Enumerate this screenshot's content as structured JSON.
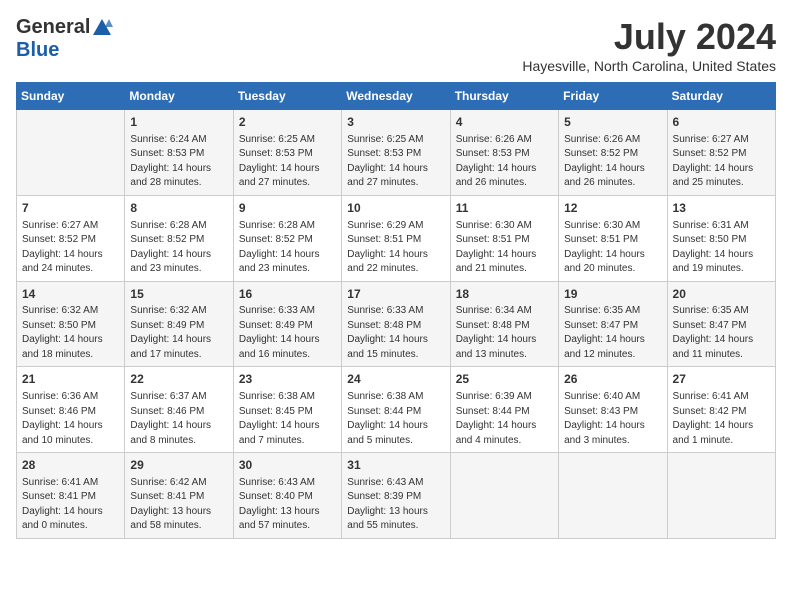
{
  "logo": {
    "general": "General",
    "blue": "Blue"
  },
  "title": {
    "month_year": "July 2024",
    "location": "Hayesville, North Carolina, United States"
  },
  "days_of_week": [
    "Sunday",
    "Monday",
    "Tuesday",
    "Wednesday",
    "Thursday",
    "Friday",
    "Saturday"
  ],
  "weeks": [
    [
      {
        "day": "",
        "info": ""
      },
      {
        "day": "1",
        "info": "Sunrise: 6:24 AM\nSunset: 8:53 PM\nDaylight: 14 hours\nand 28 minutes."
      },
      {
        "day": "2",
        "info": "Sunrise: 6:25 AM\nSunset: 8:53 PM\nDaylight: 14 hours\nand 27 minutes."
      },
      {
        "day": "3",
        "info": "Sunrise: 6:25 AM\nSunset: 8:53 PM\nDaylight: 14 hours\nand 27 minutes."
      },
      {
        "day": "4",
        "info": "Sunrise: 6:26 AM\nSunset: 8:53 PM\nDaylight: 14 hours\nand 26 minutes."
      },
      {
        "day": "5",
        "info": "Sunrise: 6:26 AM\nSunset: 8:52 PM\nDaylight: 14 hours\nand 26 minutes."
      },
      {
        "day": "6",
        "info": "Sunrise: 6:27 AM\nSunset: 8:52 PM\nDaylight: 14 hours\nand 25 minutes."
      }
    ],
    [
      {
        "day": "7",
        "info": "Sunrise: 6:27 AM\nSunset: 8:52 PM\nDaylight: 14 hours\nand 24 minutes."
      },
      {
        "day": "8",
        "info": "Sunrise: 6:28 AM\nSunset: 8:52 PM\nDaylight: 14 hours\nand 23 minutes."
      },
      {
        "day": "9",
        "info": "Sunrise: 6:28 AM\nSunset: 8:52 PM\nDaylight: 14 hours\nand 23 minutes."
      },
      {
        "day": "10",
        "info": "Sunrise: 6:29 AM\nSunset: 8:51 PM\nDaylight: 14 hours\nand 22 minutes."
      },
      {
        "day": "11",
        "info": "Sunrise: 6:30 AM\nSunset: 8:51 PM\nDaylight: 14 hours\nand 21 minutes."
      },
      {
        "day": "12",
        "info": "Sunrise: 6:30 AM\nSunset: 8:51 PM\nDaylight: 14 hours\nand 20 minutes."
      },
      {
        "day": "13",
        "info": "Sunrise: 6:31 AM\nSunset: 8:50 PM\nDaylight: 14 hours\nand 19 minutes."
      }
    ],
    [
      {
        "day": "14",
        "info": "Sunrise: 6:32 AM\nSunset: 8:50 PM\nDaylight: 14 hours\nand 18 minutes."
      },
      {
        "day": "15",
        "info": "Sunrise: 6:32 AM\nSunset: 8:49 PM\nDaylight: 14 hours\nand 17 minutes."
      },
      {
        "day": "16",
        "info": "Sunrise: 6:33 AM\nSunset: 8:49 PM\nDaylight: 14 hours\nand 16 minutes."
      },
      {
        "day": "17",
        "info": "Sunrise: 6:33 AM\nSunset: 8:48 PM\nDaylight: 14 hours\nand 15 minutes."
      },
      {
        "day": "18",
        "info": "Sunrise: 6:34 AM\nSunset: 8:48 PM\nDaylight: 14 hours\nand 13 minutes."
      },
      {
        "day": "19",
        "info": "Sunrise: 6:35 AM\nSunset: 8:47 PM\nDaylight: 14 hours\nand 12 minutes."
      },
      {
        "day": "20",
        "info": "Sunrise: 6:35 AM\nSunset: 8:47 PM\nDaylight: 14 hours\nand 11 minutes."
      }
    ],
    [
      {
        "day": "21",
        "info": "Sunrise: 6:36 AM\nSunset: 8:46 PM\nDaylight: 14 hours\nand 10 minutes."
      },
      {
        "day": "22",
        "info": "Sunrise: 6:37 AM\nSunset: 8:46 PM\nDaylight: 14 hours\nand 8 minutes."
      },
      {
        "day": "23",
        "info": "Sunrise: 6:38 AM\nSunset: 8:45 PM\nDaylight: 14 hours\nand 7 minutes."
      },
      {
        "day": "24",
        "info": "Sunrise: 6:38 AM\nSunset: 8:44 PM\nDaylight: 14 hours\nand 5 minutes."
      },
      {
        "day": "25",
        "info": "Sunrise: 6:39 AM\nSunset: 8:44 PM\nDaylight: 14 hours\nand 4 minutes."
      },
      {
        "day": "26",
        "info": "Sunrise: 6:40 AM\nSunset: 8:43 PM\nDaylight: 14 hours\nand 3 minutes."
      },
      {
        "day": "27",
        "info": "Sunrise: 6:41 AM\nSunset: 8:42 PM\nDaylight: 14 hours\nand 1 minute."
      }
    ],
    [
      {
        "day": "28",
        "info": "Sunrise: 6:41 AM\nSunset: 8:41 PM\nDaylight: 14 hours\nand 0 minutes."
      },
      {
        "day": "29",
        "info": "Sunrise: 6:42 AM\nSunset: 8:41 PM\nDaylight: 13 hours\nand 58 minutes."
      },
      {
        "day": "30",
        "info": "Sunrise: 6:43 AM\nSunset: 8:40 PM\nDaylight: 13 hours\nand 57 minutes."
      },
      {
        "day": "31",
        "info": "Sunrise: 6:43 AM\nSunset: 8:39 PM\nDaylight: 13 hours\nand 55 minutes."
      },
      {
        "day": "",
        "info": ""
      },
      {
        "day": "",
        "info": ""
      },
      {
        "day": "",
        "info": ""
      }
    ]
  ]
}
